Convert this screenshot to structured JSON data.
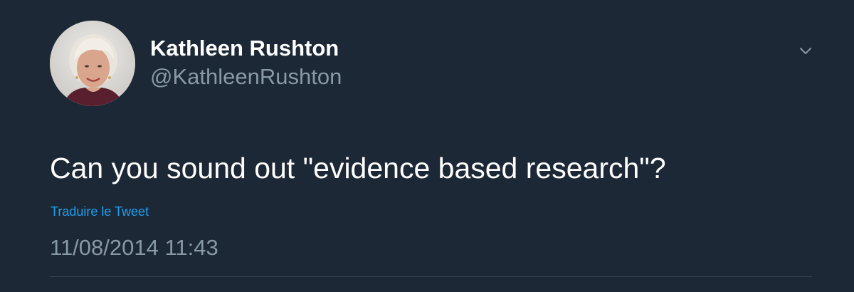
{
  "author": {
    "display_name": "Kathleen Rushton",
    "handle": "@KathleenRushton",
    "avatar_icon": "profile-photo"
  },
  "tweet": {
    "text": "Can you sound out \"evidence based research\"?",
    "translate_label": "Traduire le Tweet",
    "timestamp": "11/08/2014 11:43"
  },
  "menu": {
    "icon": "chevron-down-icon"
  },
  "colors": {
    "background": "#1c2836",
    "primary_text": "#ffffff",
    "secondary_text": "#8899a6",
    "link": "#1da1f2",
    "divider": "#38444d"
  }
}
